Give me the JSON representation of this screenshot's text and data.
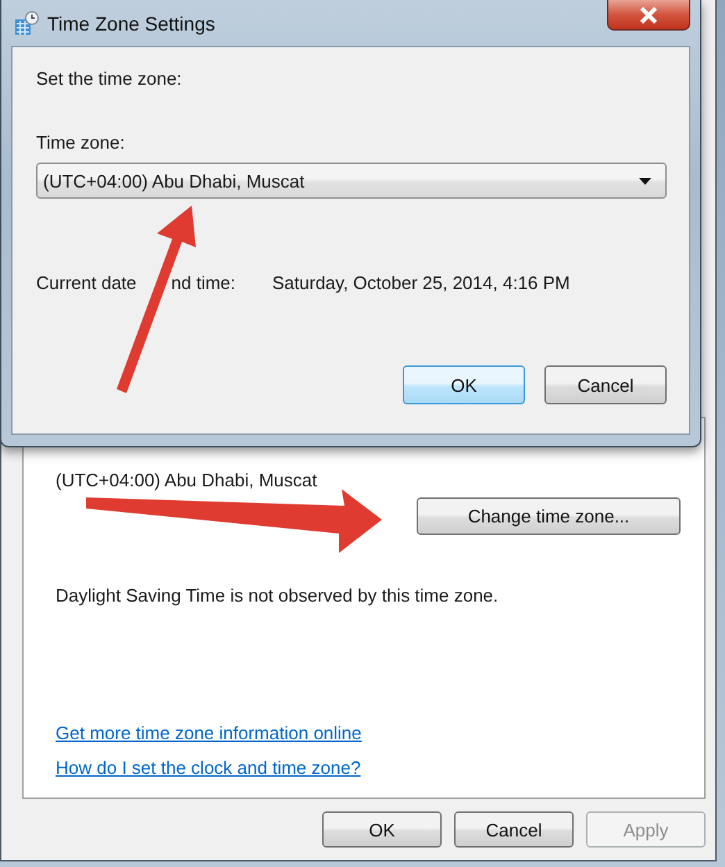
{
  "dialog": {
    "title": "Time Zone Settings",
    "prompt": "Set the time zone:",
    "time_zone_label": "Time zone:",
    "time_zone_value": "(UTC+04:00) Abu Dhabi, Muscat",
    "current_label_parts": [
      "Current date",
      "nd time:"
    ],
    "current_value": "Saturday, October 25, 2014, 4:16 PM",
    "buttons": [
      {
        "label": "OK",
        "default": true
      },
      {
        "label": "Cancel",
        "default": false
      }
    ]
  },
  "window": {
    "time_zone": "(UTC+04:00) Abu Dhabi, Muscat",
    "change_button": "Change time zone...",
    "dst_note": "Daylight Saving Time is not observed by this time zone.",
    "links": [
      "Get more time zone information online",
      "How do I set the clock and time zone?"
    ],
    "buttons": [
      {
        "label": "OK",
        "disabled": false
      },
      {
        "label": "Cancel",
        "disabled": false
      },
      {
        "label": "Apply",
        "disabled": true
      }
    ]
  }
}
